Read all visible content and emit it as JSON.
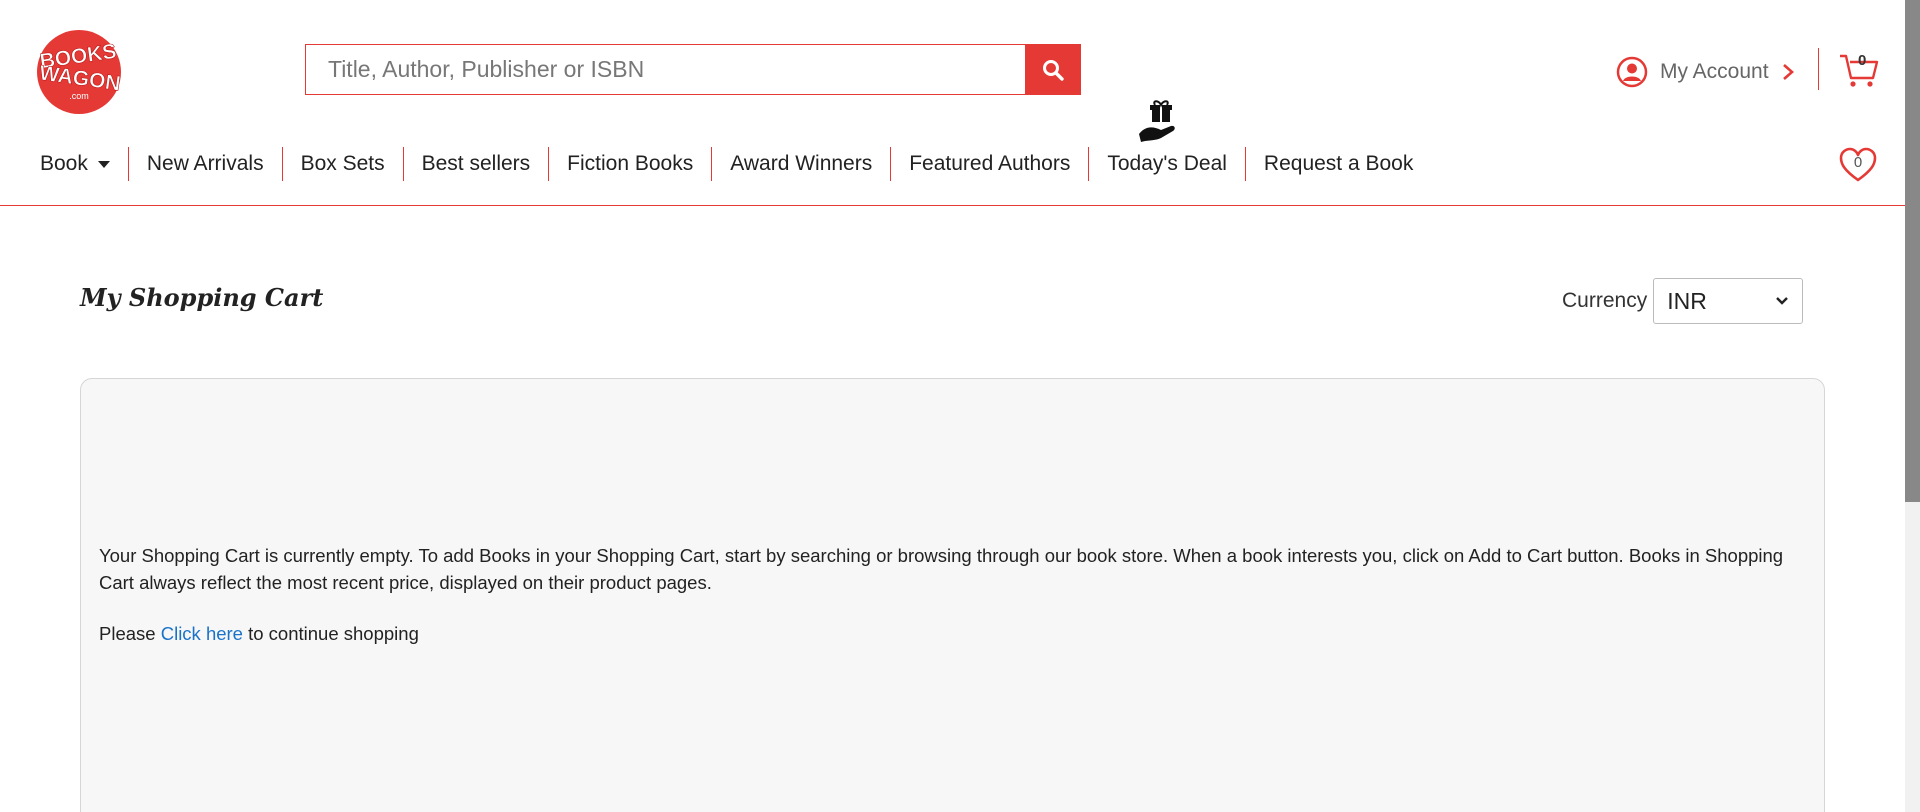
{
  "brand": {
    "logo_line1": "BOOKS",
    "logo_line2": "WAGON",
    "logo_line3": ".com",
    "accent_color": "#e53935"
  },
  "search": {
    "placeholder": "Title, Author, Publisher or ISBN",
    "button_icon": "search-icon"
  },
  "account": {
    "label": "My Account",
    "icon": "user-circle-icon"
  },
  "cart": {
    "count": "0",
    "icon": "cart-icon"
  },
  "wishlist": {
    "count": "0",
    "icon": "heart-icon"
  },
  "nav": {
    "items": [
      {
        "label": "Book"
      },
      {
        "label": "New Arrivals"
      },
      {
        "label": "Box Sets"
      },
      {
        "label": "Best sellers"
      },
      {
        "label": "Fiction Books"
      },
      {
        "label": "Award Winners"
      },
      {
        "label": "Featured Authors"
      },
      {
        "label": "Today's Deal"
      },
      {
        "label": "Request a Book"
      }
    ],
    "deal_icon": "gift-hand-icon"
  },
  "main": {
    "title": "My Shopping Cart",
    "currency_label": "Currency",
    "currency_value": "INR",
    "empty_message": "Your Shopping Cart is currently empty. To add Books in your Shopping Cart, start by searching or browsing through our book store. When a book interests you, click on Add to Cart button. Books in Shopping Cart always reflect the most recent price, displayed on their product pages.",
    "continue_prefix": "Please",
    "continue_link": "Click here",
    "continue_suffix": "to continue shopping",
    "link_color": "#1a73c9"
  }
}
